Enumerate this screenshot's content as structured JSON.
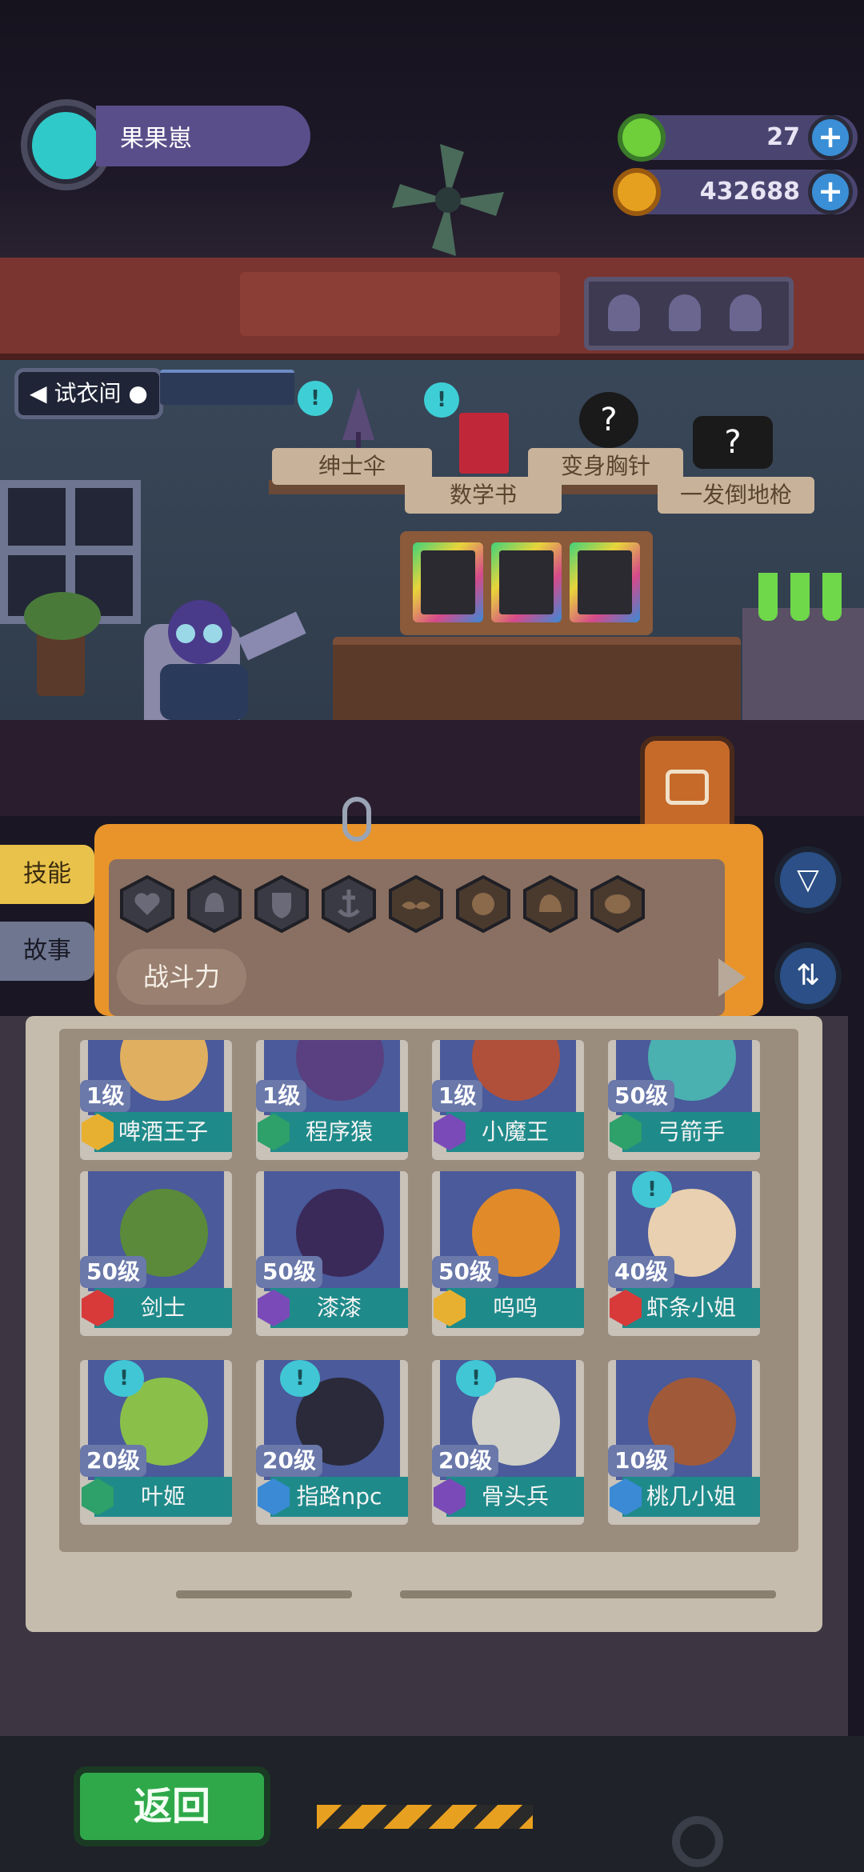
{
  "player": {
    "name": "果果崽"
  },
  "currency": {
    "gems": "27",
    "coins": "432688",
    "colors": {
      "gem": "#6fcf3a",
      "coin": "#e6a020"
    }
  },
  "room": {
    "dressing_room_label": "试衣间",
    "shelf_items": [
      {
        "label": "绅士伞",
        "icon": "umbrella-icon"
      },
      {
        "label": "数学书",
        "icon": "book-icon"
      },
      {
        "label": "变身胸针",
        "icon": "mystery-brooch-icon"
      },
      {
        "label": "一发倒地枪",
        "icon": "mystery-gun-icon"
      }
    ],
    "notice_bubble": "!"
  },
  "side_tabs": {
    "skills": "技能",
    "story": "故事"
  },
  "filter_panel": {
    "sort_label": "战斗力",
    "filter_icons": [
      "heart-icon",
      "bell-icon",
      "shield-icon",
      "anchor-icon",
      "mustache-icon",
      "smile-icon",
      "muscle-icon",
      "brain-icon"
    ]
  },
  "characters": [
    {
      "name": "啤酒王子",
      "level": "1级",
      "rank_color": "#e8b030",
      "art": "#e0b060",
      "bubble": false
    },
    {
      "name": "程序猿",
      "level": "1级",
      "rank_color": "#2ea06a",
      "art": "#5a4080",
      "bubble": false
    },
    {
      "name": "小魔王",
      "level": "1级",
      "rank_color": "#7a4ab8",
      "art": "#b0503a",
      "bubble": false
    },
    {
      "name": "弓箭手",
      "level": "50级",
      "rank_color": "#2ea06a",
      "art": "#4ab0b0",
      "bubble": false
    },
    {
      "name": "剑士",
      "level": "50级",
      "rank_color": "#d83a3a",
      "art": "#5a8a3a",
      "bubble": false
    },
    {
      "name": "漆漆",
      "level": "50级",
      "rank_color": "#7a4ab8",
      "art": "#3a2a5a",
      "bubble": false
    },
    {
      "name": "呜呜",
      "level": "50级",
      "rank_color": "#e8b030",
      "art": "#e08a2a",
      "bubble": false
    },
    {
      "name": "虾条小姐",
      "level": "40级",
      "rank_color": "#d83a3a",
      "art": "#e8d0b0",
      "bubble": true
    },
    {
      "name": "叶姬",
      "level": "20级",
      "rank_color": "#2ea06a",
      "art": "#8ac04a",
      "bubble": true
    },
    {
      "name": "指路npc",
      "level": "20级",
      "rank_color": "#3a8ad6",
      "art": "#2a2a3a",
      "bubble": true
    },
    {
      "name": "骨头兵",
      "level": "20级",
      "rank_color": "#7a4ab8",
      "art": "#d0d0c8",
      "bubble": true
    },
    {
      "name": "桃几小姐",
      "level": "10级",
      "rank_color": "#3a8ad6",
      "art": "#a05a3a",
      "bubble": false
    }
  ],
  "footer": {
    "back_label": "返回"
  }
}
